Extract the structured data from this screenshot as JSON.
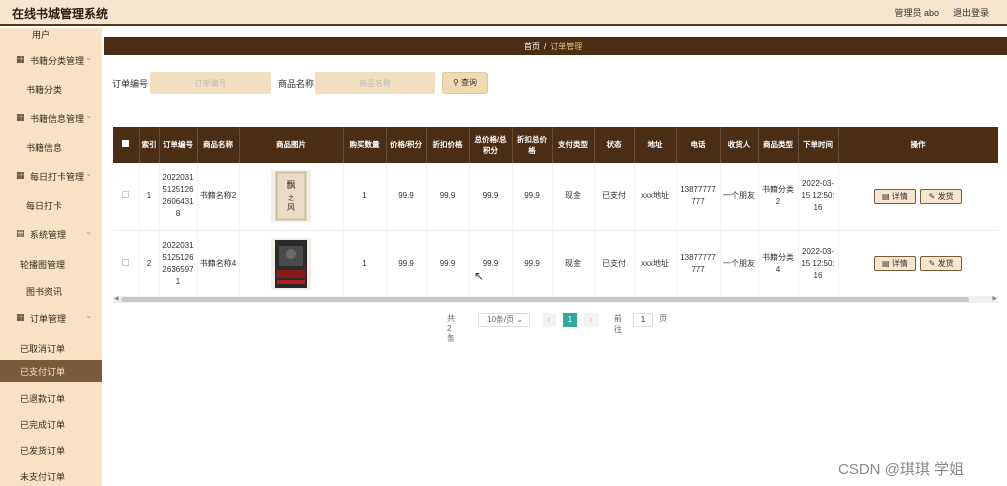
{
  "header": {
    "app_title": "在线书城管理系统",
    "user": "管理员 abo",
    "logout": "退出登录"
  },
  "sidebar": {
    "items": [
      {
        "label": "用户",
        "type": "sub"
      },
      {
        "label": "书籍分类管理",
        "type": "group"
      },
      {
        "label": "书籍分类",
        "type": "sub"
      },
      {
        "label": "书籍信息管理",
        "type": "group"
      },
      {
        "label": "书籍信息",
        "type": "sub"
      },
      {
        "label": "每日打卡管理",
        "type": "group"
      },
      {
        "label": "每日打卡",
        "type": "sub"
      },
      {
        "label": "系统管理",
        "type": "group"
      },
      {
        "label": "轮播图管理",
        "type": "sub"
      },
      {
        "label": "图书资讯",
        "type": "sub"
      },
      {
        "label": "订单管理",
        "type": "group"
      },
      {
        "label": "已取消订单",
        "type": "sub2"
      },
      {
        "label": "已支付订单",
        "type": "sub2",
        "active": true
      },
      {
        "label": "已退款订单",
        "type": "sub2"
      },
      {
        "label": "已完成订单",
        "type": "sub2"
      },
      {
        "label": "已发货订单",
        "type": "sub2"
      },
      {
        "label": "未支付订单",
        "type": "sub2"
      }
    ]
  },
  "breadcrumb": {
    "home": "首页",
    "sep": "/",
    "current": "订单管理"
  },
  "search": {
    "order_no_label": "订单编号",
    "order_no_placeholder": "订单编号",
    "product_name_label": "商品名称",
    "product_name_placeholder": "商品名称",
    "query_button": "查询"
  },
  "table": {
    "columns": [
      "索引",
      "订单编号",
      "商品名称",
      "商品图片",
      "购买数量",
      "价格/积分",
      "折扣价格",
      "总价格/总积分",
      "折扣总价格",
      "支付类型",
      "状态",
      "地址",
      "电话",
      "收货人",
      "商品类型",
      "下单时间",
      "操作"
    ],
    "rows": [
      {
        "index": "1",
        "order_no": "2022031512512626064318",
        "product_name": "书籍名称2",
        "quantity": "1",
        "price": "99.9",
        "discount_price": "99.9",
        "total_price": "99.9",
        "discount_total": "99.9",
        "pay_type": "现金",
        "status": "已支付",
        "address": "xxx地址",
        "phone": "13877777777",
        "receiver": "一个朋友",
        "product_type": "书籍分类2",
        "order_time": "2022-03-15 12:50:16",
        "detail_btn": "详情",
        "ship_btn": "发货"
      },
      {
        "index": "2",
        "order_no": "2022031512512626365971",
        "product_name": "书籍名称4",
        "quantity": "1",
        "price": "99.9",
        "discount_price": "99.9",
        "total_price": "99.9",
        "discount_total": "99.9",
        "pay_type": "现金",
        "status": "已支付",
        "address": "xxx地址",
        "phone": "13877777777",
        "receiver": "一个朋友",
        "product_type": "书籍分类4",
        "order_time": "2022-03-15 12:50:16",
        "detail_btn": "详情",
        "ship_btn": "发货"
      }
    ]
  },
  "pagination": {
    "total": "共 2 条",
    "page_size": "10条/页",
    "current_page": "1",
    "goto_label": "前往",
    "goto_value": "1",
    "page_suffix": "页"
  },
  "watermark": "CSDN @琪琪 学姐"
}
